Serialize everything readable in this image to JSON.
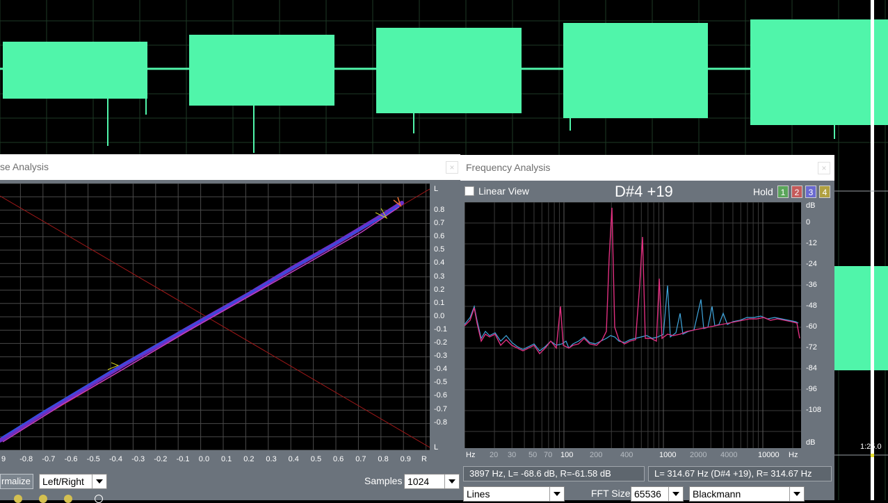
{
  "wave": {
    "color": "#50f5aa",
    "time_marker": "1:25.0"
  },
  "phase_window": {
    "title": "se Analysis",
    "close": "×",
    "scale_top": "L",
    "scale_bottom": "L",
    "y_ticks": [
      "0.8",
      "0.7",
      "0.6",
      "0.5",
      "0.4",
      "0.3",
      "0.2",
      "0.1",
      "0.0",
      "-0.1",
      "-0.2",
      "-0.3",
      "-0.4",
      "-0.5",
      "-0.6",
      "-0.7",
      "-0.8"
    ],
    "x_ticks": [
      "9",
      "-0.8",
      "-0.7",
      "-0.6",
      "-0.5",
      "-0.4",
      "-0.3",
      "-0.2",
      "-0.1",
      "0.0",
      "0.1",
      "0.2",
      "0.3",
      "0.4",
      "0.5",
      "0.6",
      "0.7",
      "0.8",
      "0.9",
      "R"
    ],
    "normalize_label": "rmalize",
    "channel_mode": "Left/Right",
    "samples_label": "Samples",
    "samples_value": "1024"
  },
  "freq_window": {
    "title": "Frequency Analysis",
    "close": "×",
    "linear_view_label": "Linear View",
    "note": "D#4 +19",
    "hold_label": "Hold",
    "hold_buttons": [
      {
        "label": "1",
        "color": "#5aa55a"
      },
      {
        "label": "2",
        "color": "#c45a5a"
      },
      {
        "label": "3",
        "color": "#6a6ad0"
      },
      {
        "label": "4",
        "color": "#b0a040"
      }
    ],
    "db_label_top": "dB",
    "db_label_bottom": "dB",
    "db_ticks": [
      "0",
      "-12",
      "-24",
      "-36",
      "-48",
      "-60",
      "-72",
      "-84",
      "-96",
      "-108"
    ],
    "hz_left": "Hz",
    "hz_right": "Hz",
    "x_ticks": [
      "20",
      "30",
      "50",
      "70",
      "100",
      "200",
      "400",
      "1000",
      "2000",
      "4000",
      "10000"
    ],
    "cursor_readout": "3897 Hz, L= -68.6 dB, R=-61.58 dB",
    "peak_readout": "L= 314.67 Hz (D#4 +19), R= 314.67 Hz",
    "graph_type": "Lines",
    "fft_label": "FFT Size",
    "fft_value": "65536",
    "window_fn": "Blackmann"
  }
}
